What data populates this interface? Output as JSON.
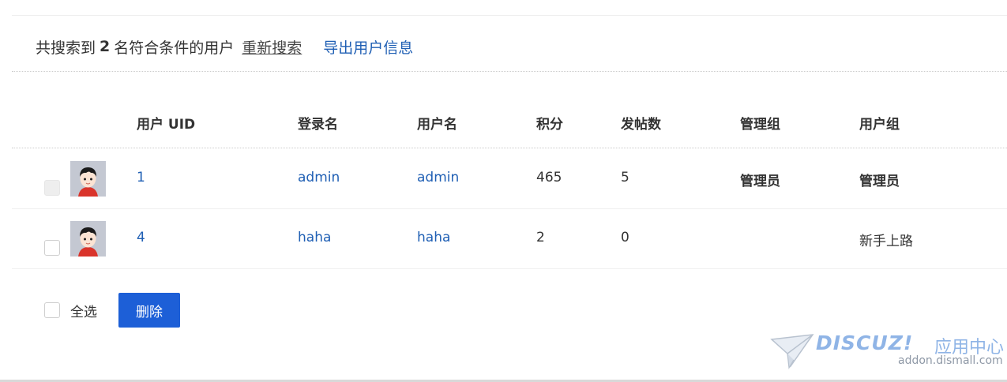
{
  "result": {
    "prefix": "共搜索到",
    "count": "2",
    "suffix": "名符合条件的用户",
    "research_label": "重新搜索",
    "export_label": "导出用户信息"
  },
  "table": {
    "columns": [
      "用户 UID",
      "登录名",
      "用户名",
      "积分",
      "发帖数",
      "管理组",
      "用户组"
    ],
    "rows": [
      {
        "uid": "1",
        "login": "admin",
        "username": "admin",
        "credits": "465",
        "posts": "5",
        "admin_group": "管理员",
        "user_group": "管理员",
        "checkbox_disabled": true
      },
      {
        "uid": "4",
        "login": "haha",
        "username": "haha",
        "credits": "2",
        "posts": "0",
        "admin_group": "",
        "user_group": "新手上路",
        "checkbox_disabled": false
      }
    ]
  },
  "footer": {
    "select_all_label": "全选",
    "delete_label": "删除"
  },
  "watermark": {
    "brand": "DISCUZ!",
    "brand_cn": "应用中心",
    "url": "addon.dismall.com"
  },
  "colors": {
    "link": "#1f5fb4",
    "primary_button": "#1d5fd7",
    "watermark": "#8fb4e6"
  }
}
